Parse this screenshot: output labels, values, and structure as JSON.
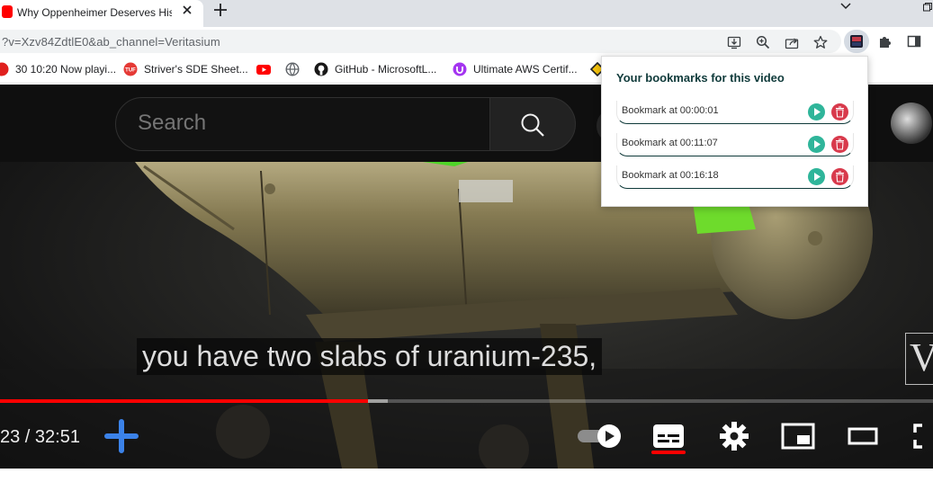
{
  "tab": {
    "title": "Why Oppenheimer Deserves His"
  },
  "address": {
    "url": "?v=Xzv84ZdtlE0&ab_channel=Veritasium"
  },
  "bookmarks_bar": [
    {
      "label": "30 10:20 Now playi...",
      "icon": "music-icon"
    },
    {
      "label": "Striver's SDE Sheet...",
      "icon": "tuf-icon"
    },
    {
      "label": "",
      "icon": "youtube-icon"
    },
    {
      "label": "",
      "icon": "globe-icon"
    },
    {
      "label": "GitHub - MicrosoftL...",
      "icon": "github-icon"
    },
    {
      "label": "Ultimate AWS Certif...",
      "icon": "course-icon"
    }
  ],
  "youtube": {
    "search_placeholder": "Search",
    "caption": "you have two slabs of uranium-235,",
    "time": "23 / 32:51",
    "watermark": "V",
    "progress_fraction": 0.394,
    "buffer_fraction": 0.416
  },
  "popup": {
    "title": "Your bookmarks for this video",
    "bookmarks": [
      {
        "label": "Bookmark at 00:00:01"
      },
      {
        "label": "Bookmark at 00:11:07"
      },
      {
        "label": "Bookmark at 00:16:18"
      }
    ]
  },
  "colors": {
    "accent_teal": "#2fb59a",
    "delete_red": "#d83a4c",
    "youtube_red": "#ff0000",
    "popup_heading": "#0f3a3a"
  }
}
